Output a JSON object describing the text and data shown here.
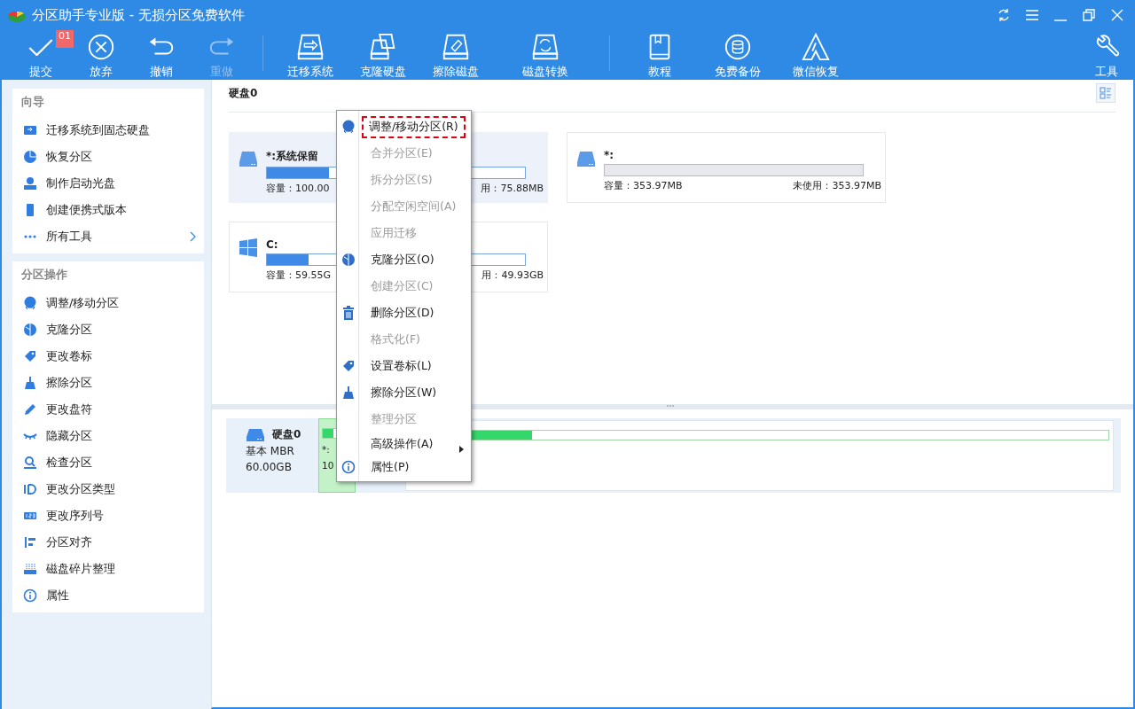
{
  "window": {
    "title": "分区助手专业版 - 无损分区免费软件"
  },
  "toolbar": {
    "groups": [
      [
        {
          "label": "提交",
          "disabled": false,
          "badge": "01"
        },
        {
          "label": "放弃",
          "disabled": false
        },
        {
          "label": "撤销",
          "disabled": false
        },
        {
          "label": "重做",
          "disabled": true
        }
      ],
      [
        {
          "label": "迁移系统",
          "disabled": false
        },
        {
          "label": "克隆硬盘",
          "disabled": false
        },
        {
          "label": "擦除磁盘",
          "disabled": false
        },
        {
          "label": "磁盘转换",
          "disabled": false
        }
      ],
      [
        {
          "label": "教程",
          "disabled": false
        },
        {
          "label": "免费备份",
          "disabled": false
        },
        {
          "label": "微信恢复",
          "disabled": false
        }
      ],
      [
        {
          "label": "工具",
          "disabled": false
        }
      ]
    ]
  },
  "sidebar": {
    "sections": [
      {
        "title": "向导",
        "items": [
          {
            "label": "迁移系统到固态硬盘"
          },
          {
            "label": "恢复分区"
          },
          {
            "label": "制作启动光盘"
          },
          {
            "label": "创建便携式版本"
          },
          {
            "label": "所有工具",
            "has_submenu": true
          }
        ]
      },
      {
        "title": "分区操作",
        "items": [
          {
            "label": "调整/移动分区"
          },
          {
            "label": "克隆分区"
          },
          {
            "label": "更改卷标"
          },
          {
            "label": "擦除分区"
          },
          {
            "label": "更改盘符"
          },
          {
            "label": "隐藏分区"
          },
          {
            "label": "检查分区"
          },
          {
            "label": "更改分区类型"
          },
          {
            "label": "更改序列号"
          },
          {
            "label": "分区对齐"
          },
          {
            "label": "磁盘碎片整理"
          },
          {
            "label": "属性"
          }
        ]
      }
    ]
  },
  "disk_view": {
    "title": "硬盘0",
    "cards": [
      {
        "kind": "system",
        "name": "*:系统保留",
        "selected": true,
        "level": 0.24,
        "capacity": "容量：100.00",
        "free": "用：75.88MB"
      },
      {
        "kind": "unallocated",
        "name": "*:",
        "selected": false,
        "capacity": "容量：353.97MB",
        "free": "未使用：353.97MB"
      },
      {
        "kind": "windows",
        "name": "C:",
        "selected": false,
        "level": 0.16,
        "capacity": "容量：59.55G",
        "free": "用：49.93GB"
      }
    ]
  },
  "disk_map": {
    "disk": {
      "name": "硬盘0",
      "type": "基本 MBR",
      "size": "60.00GB"
    },
    "partitions": [
      {
        "name": "*:",
        "size": "10",
        "selected": true,
        "level": 0.4
      },
      {
        "selected": false,
        "level": 0.17
      }
    ]
  },
  "context_menu": {
    "items": [
      {
        "label": "调整/移动分区(R)",
        "disabled": false,
        "highlighted": true
      },
      {
        "label": "合并分区(E)",
        "disabled": true,
        "highlighted": false
      },
      {
        "label": "拆分分区(S)",
        "disabled": true,
        "highlighted": false
      },
      {
        "label": "分配空闲空间(A)",
        "disabled": true,
        "highlighted": false
      },
      {
        "label": "应用迁移",
        "disabled": true,
        "highlighted": false
      },
      {
        "label": "克隆分区(O)",
        "disabled": false,
        "highlighted": false
      },
      {
        "label": "创建分区(C)",
        "disabled": true,
        "highlighted": false
      },
      {
        "label": "删除分区(D)",
        "disabled": false,
        "highlighted": false
      },
      {
        "label": "格式化(F)",
        "disabled": true,
        "highlighted": false
      },
      {
        "label": "设置卷标(L)",
        "disabled": false,
        "highlighted": false
      },
      {
        "label": "擦除分区(W)",
        "disabled": false,
        "highlighted": false
      },
      {
        "label": "整理分区",
        "disabled": true,
        "highlighted": false
      },
      {
        "label": "高级操作(A)",
        "disabled": false,
        "highlighted": false,
        "has_submenu": true
      },
      {
        "label": "属性(P)",
        "disabled": false,
        "highlighted": false
      }
    ]
  }
}
